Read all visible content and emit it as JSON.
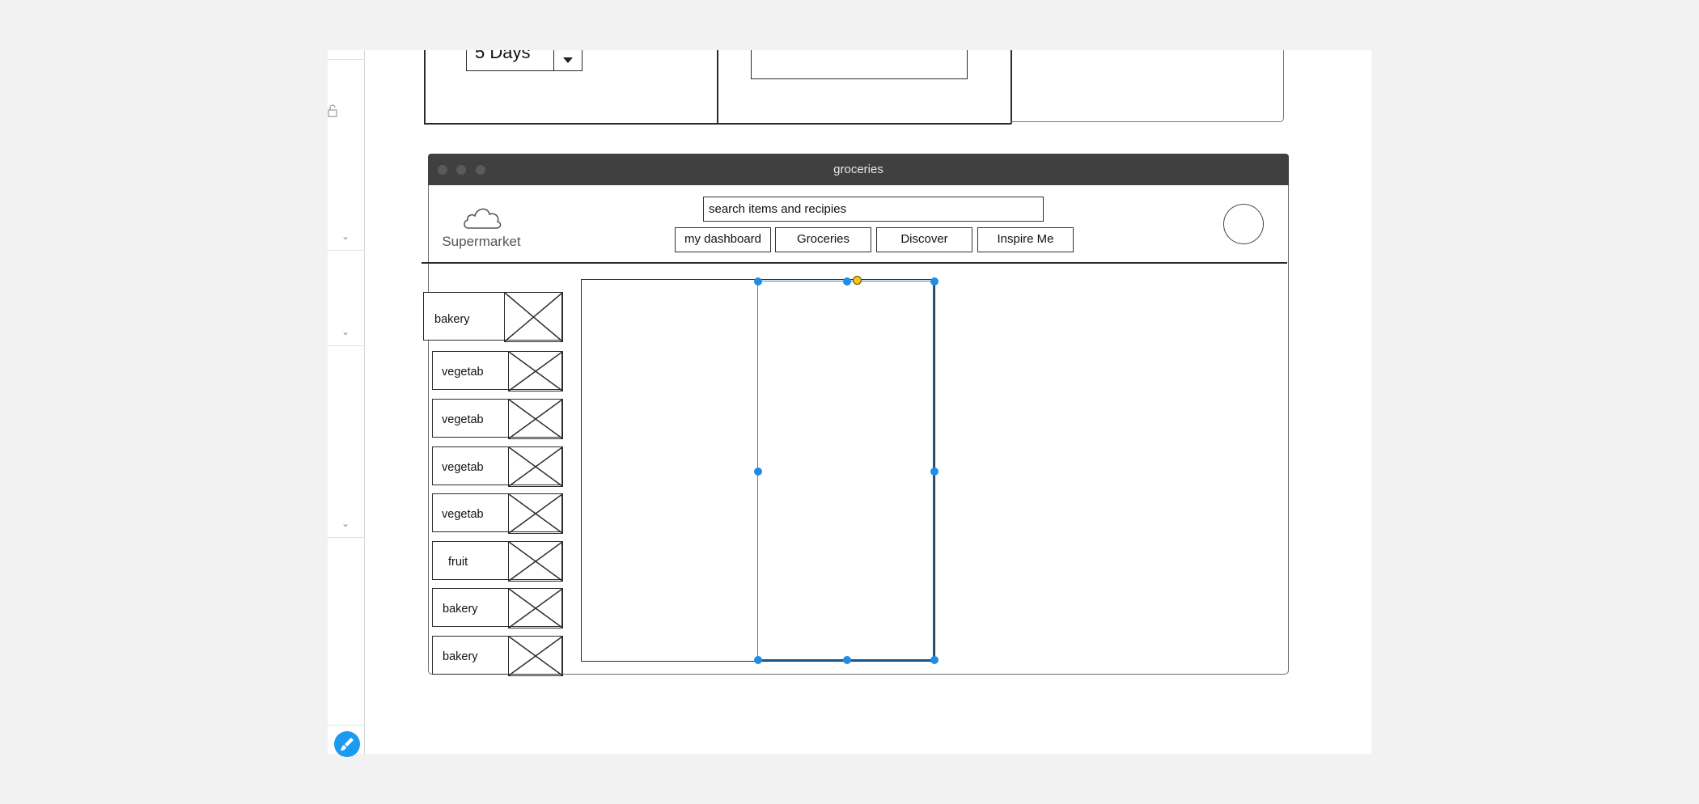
{
  "dropdown": {
    "value": "5 Days"
  },
  "window": {
    "title": "groceries"
  },
  "header": {
    "logo_text": "Supermarket",
    "search_value": "search items and recipies",
    "nav": [
      "my dashboard",
      "Groceries",
      "Discover",
      "Inspire Me"
    ]
  },
  "categories": [
    "bakery",
    "vegetab",
    "vegetab",
    "vegetab",
    "vegetab",
    "fruit",
    "bakery",
    "bakery"
  ],
  "colors": {
    "selection": "#1f8ce6",
    "rotate_handle": "#f5c518",
    "titlebar": "#404040",
    "brush_button": "#1a9bf0"
  },
  "icons": [
    "lock-icon",
    "chevron-down-icon",
    "cloud-icon",
    "caret-down-icon",
    "brush-icon"
  ]
}
